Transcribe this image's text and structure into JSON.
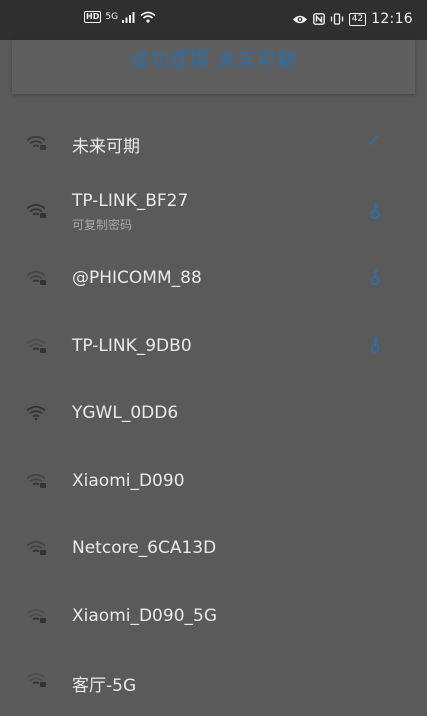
{
  "status_bar": {
    "left_badge": "HD",
    "left_signal": "5G",
    "time": "12:16",
    "battery": "42"
  },
  "toast": {
    "text": "成功连接 未来可期"
  },
  "networks": [
    {
      "name": "未来可期",
      "sub": "",
      "trailing": "check"
    },
    {
      "name": "TP-LINK_BF27",
      "sub": "可复制密码",
      "trailing": "key"
    },
    {
      "name": "@PHICOMM_88",
      "sub": "",
      "trailing": "key"
    },
    {
      "name": "TP-LINK_9DB0",
      "sub": "",
      "trailing": "key"
    },
    {
      "name": "YGWL_0DD6",
      "sub": "",
      "trailing": ""
    },
    {
      "name": "Xiaomi_D090",
      "sub": "",
      "trailing": ""
    },
    {
      "name": "Netcore_6CA13D",
      "sub": "",
      "trailing": ""
    },
    {
      "name": "Xiaomi_D090_5G",
      "sub": "",
      "trailing": ""
    },
    {
      "name": "客厅-5G",
      "sub": "",
      "trailing": ""
    }
  ],
  "colors": {
    "accent": "#2e6ea6",
    "background": "#5a5a5a",
    "status_bar": "#2f2f2f"
  },
  "icons": {
    "wifi": "wifi-lock-icon",
    "check": "check-icon",
    "key": "key-icon"
  }
}
